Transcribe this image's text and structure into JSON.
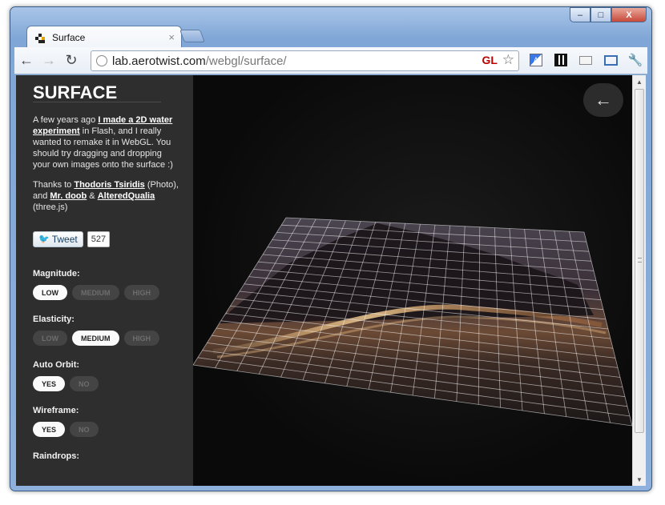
{
  "browser": {
    "tab_title": "Surface",
    "tab_close": "×",
    "url_host": "lab.aerotwist.com",
    "url_path": "/webgl/surface/",
    "gl_badge": "GL",
    "window_controls": {
      "minimize": "–",
      "maximize": "□",
      "close": "X"
    },
    "toolbar_icons": [
      "translate-icon",
      "qr-code-icon",
      "mail-icon",
      "fullscreen-icon",
      "wrench-icon"
    ]
  },
  "sidebar": {
    "title": "SURFACE",
    "intro": {
      "p1": "A few years ago ",
      "link1": "I made a 2D water experiment",
      "p2": " in Flash, and I really wanted to remake it in WebGL. You should try dragging and dropping your own images onto the surface :)"
    },
    "thanks": {
      "p1": "Thanks to ",
      "link1": "Thodoris Tsiridis",
      "p2": " (Photo), and ",
      "link2": "Mr. doob",
      "p3": " & ",
      "link3": "AlteredQualia",
      "p4": " (three.js)"
    },
    "tweet_label": "Tweet",
    "tweet_count": "527",
    "controls": [
      {
        "label": "Magnitude:",
        "options": [
          "LOW",
          "MEDIUM",
          "HIGH"
        ],
        "selected": "LOW"
      },
      {
        "label": "Elasticity:",
        "options": [
          "LOW",
          "MEDIUM",
          "HIGH"
        ],
        "selected": "MEDIUM"
      },
      {
        "label": "Auto Orbit:",
        "options": [
          "YES",
          "NO"
        ],
        "selected": "YES"
      },
      {
        "label": "Wireframe:",
        "options": [
          "YES",
          "NO"
        ],
        "selected": "YES"
      },
      {
        "label": "Raindrops:",
        "options": [],
        "selected": ""
      }
    ]
  },
  "stage": {
    "back_arrow": "←"
  },
  "colors": {
    "sidebar_bg": "#2e2e2e",
    "stage_bg": "#0b0b0b",
    "option_on": "#fafafa",
    "option_off": "#444444"
  }
}
